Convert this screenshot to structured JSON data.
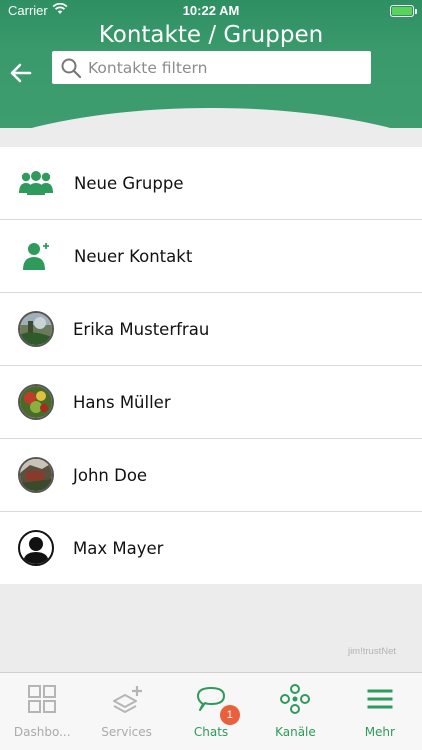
{
  "status_bar": {
    "carrier": "Carrier",
    "time": "10:22 AM"
  },
  "header": {
    "title": "Kontakte / Gruppen",
    "search_placeholder": "Kontakte filtern"
  },
  "list": {
    "items": [
      {
        "label": "Neue Gruppe",
        "icon": "group-icon"
      },
      {
        "label": "Neuer Kontakt",
        "icon": "add-contact-icon"
      },
      {
        "label": "Erika Musterfrau",
        "icon": "avatar"
      },
      {
        "label": "Hans Müller",
        "icon": "avatar"
      },
      {
        "label": "John Doe",
        "icon": "avatar"
      },
      {
        "label": "Max Mayer",
        "icon": "default-avatar-icon"
      }
    ]
  },
  "brand": "jim!trustNet",
  "tabbar": {
    "tabs": [
      {
        "label": "Dashbo...",
        "icon": "dashboard-icon"
      },
      {
        "label": "Services",
        "icon": "services-icon"
      },
      {
        "label": "Chats",
        "icon": "chat-icon",
        "badge": "1"
      },
      {
        "label": "Kanäle",
        "icon": "channels-icon"
      },
      {
        "label": "Mehr",
        "icon": "menu-icon"
      }
    ]
  },
  "colors": {
    "accent": "#2e9a5c",
    "badge": "#e8613c",
    "header": "#3a9a6c"
  }
}
